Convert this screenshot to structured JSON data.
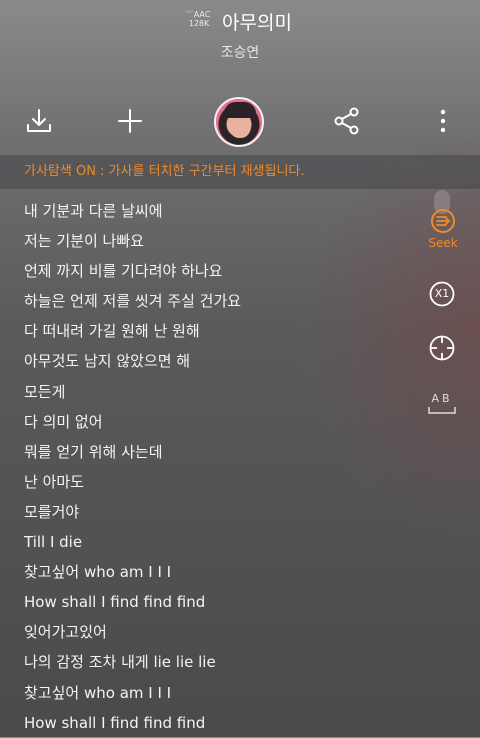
{
  "header": {
    "codec_top": "AAC",
    "codec_bottom": "128K",
    "title": "아무의미",
    "artist": "조승연"
  },
  "toolbar": {
    "download_icon": "download-icon",
    "add_icon": "plus-icon",
    "share_icon": "share-icon",
    "more_icon": "more-vertical-icon"
  },
  "notice": {
    "text": "가사탐색 ON : 가사를 터치한 구간부터 재생됩니다."
  },
  "lyrics": [
    "내 기분과 다른 날씨에",
    "저는 기분이 나빠요",
    "언제 까지 비를 기다려야 하나요",
    "하늘은 언제 저를 씻겨 주실 건가요",
    "다 떠내려 가길 원해 난 원해",
    "아무것도 남지 않았으면 해",
    "모든게",
    "다 의미 없어",
    "뭐를 얻기 위해 사는데",
    "난 아마도",
    "모를거야",
    "Till I die",
    "찾고싶어 who am I I I",
    "How shall I find find find",
    "잊어가고있어",
    "나의 감정 조차 내게 lie lie lie",
    "찾고싶어 who am I I I",
    "How shall I find find find"
  ],
  "side": {
    "seek_label": "Seek",
    "speed_label": "X1",
    "ab_label": "AB"
  },
  "colors": {
    "accent": "#f08a2a"
  }
}
